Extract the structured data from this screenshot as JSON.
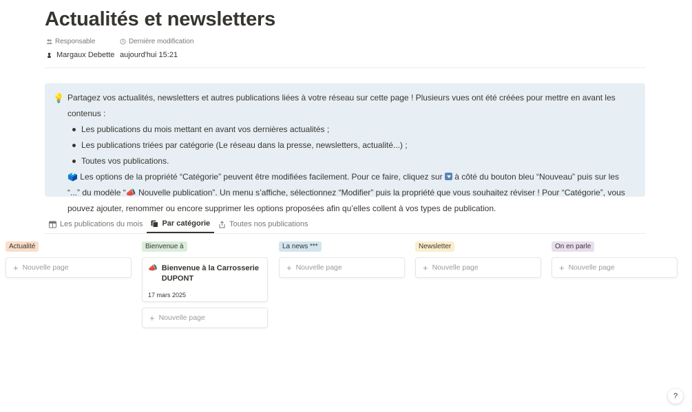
{
  "page": {
    "title": "Actualités et newsletters"
  },
  "properties": {
    "owner_label": "Responsable",
    "modified_label": "Dernière modification",
    "owner_value": "Margaux Debette",
    "modified_value": "aujourd'hui 15:21"
  },
  "callout": {
    "icon": "💡",
    "intro": "Partagez vos actualités, newsletters et autres publications liées à votre réseau sur cette page ! Plusieurs vues ont été créées pour mettre en avant les contenus :",
    "bullets": [
      "Les publications du mois mettant en avant vos dernières actualités ;",
      "Les publications triées par catégorie (Le réseau dans la presse, newsletters, actualité...) ;",
      "Toutes vos publications."
    ],
    "note_emoji": "🗳️",
    "note_part1": " Les options de la propriété “Catégorie” peuvent être modifiées facilement. Pour ce faire, cliquez sur ",
    "note_part2": " à côté du bouton bleu “Nouveau” puis sur les “...” du modèle “",
    "note_emoji2": "📣",
    "note_part3": " Nouvelle publication”. Un menu s’affiche, sélectionnez “Modifier” puis la propriété que vous souhaitez réviser ! Pour “Catégorie”, vous pouvez ajouter, renommer ou encore supprimer les options proposées afin qu’elles collent à vos types de publication."
  },
  "tabs": [
    {
      "label": "Les publications du mois",
      "icon": "table-icon"
    },
    {
      "label": "Par catégorie",
      "icon": "board-icon",
      "active": true
    },
    {
      "label": "Toutes nos publications",
      "icon": "share-icon"
    }
  ],
  "board": {
    "new_page_label": "Nouvelle page",
    "columns": [
      {
        "name": "Actualité",
        "color": "#fadec9"
      },
      {
        "name": "Bienvenue à",
        "color": "#dbeddb"
      },
      {
        "name": "La news ***",
        "color": "#d3e5ef"
      },
      {
        "name": "Newsletter",
        "color": "#fbeecb"
      },
      {
        "name": "On en parle",
        "color": "#e8deee"
      }
    ],
    "cards": [
      {
        "column": 1,
        "icon": "📣",
        "title": "Bienvenue à la Carrosserie DUPONT",
        "date": "17 mars 2025"
      }
    ]
  },
  "help": {
    "label": "?"
  }
}
